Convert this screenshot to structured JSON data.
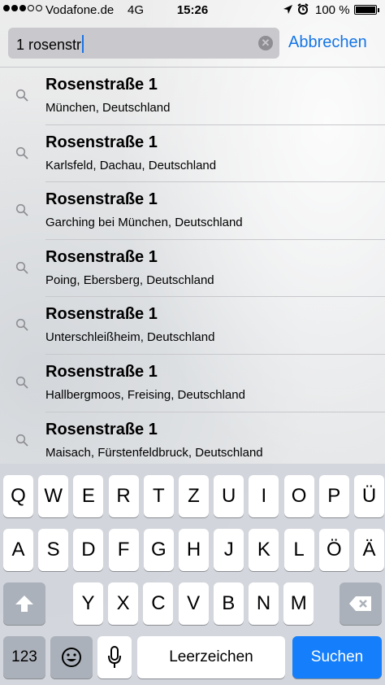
{
  "status_bar": {
    "carrier": "Vodafone.de",
    "network": "4G",
    "time": "15:26",
    "battery": "100 %",
    "signal_bars_filled": 3,
    "signal_bars_total": 5
  },
  "search": {
    "value": "1 rosenstr",
    "cancel_label": "Abbrechen"
  },
  "results": [
    {
      "title": "Rosenstraße 1",
      "subtitle": "München, Deutschland"
    },
    {
      "title": "Rosenstraße 1",
      "subtitle": "Karlsfeld, Dachau, Deutschland"
    },
    {
      "title": "Rosenstraße 1",
      "subtitle": "Garching bei München, Deutschland"
    },
    {
      "title": "Rosenstraße 1",
      "subtitle": "Poing, Ebersberg, Deutschland"
    },
    {
      "title": "Rosenstraße 1",
      "subtitle": "Unterschleißheim, Deutschland"
    },
    {
      "title": "Rosenstraße 1",
      "subtitle": "Hallbergmoos, Freising, Deutschland"
    },
    {
      "title": "Rosenstraße 1",
      "subtitle": "Maisach, Fürstenfeldbruck, Deutschland"
    }
  ],
  "keyboard": {
    "row1": [
      "Q",
      "W",
      "E",
      "R",
      "T",
      "Z",
      "U",
      "I",
      "O",
      "P",
      "Ü"
    ],
    "row2": [
      "A",
      "S",
      "D",
      "F",
      "G",
      "H",
      "J",
      "K",
      "L",
      "Ö",
      "Ä"
    ],
    "row3": [
      "Y",
      "X",
      "C",
      "V",
      "B",
      "N",
      "M"
    ],
    "numbers_label": "123",
    "space_label": "Leerzeichen",
    "search_label": "Suchen"
  },
  "colors": {
    "accent": "#1475e6",
    "search_key": "#147efb"
  }
}
